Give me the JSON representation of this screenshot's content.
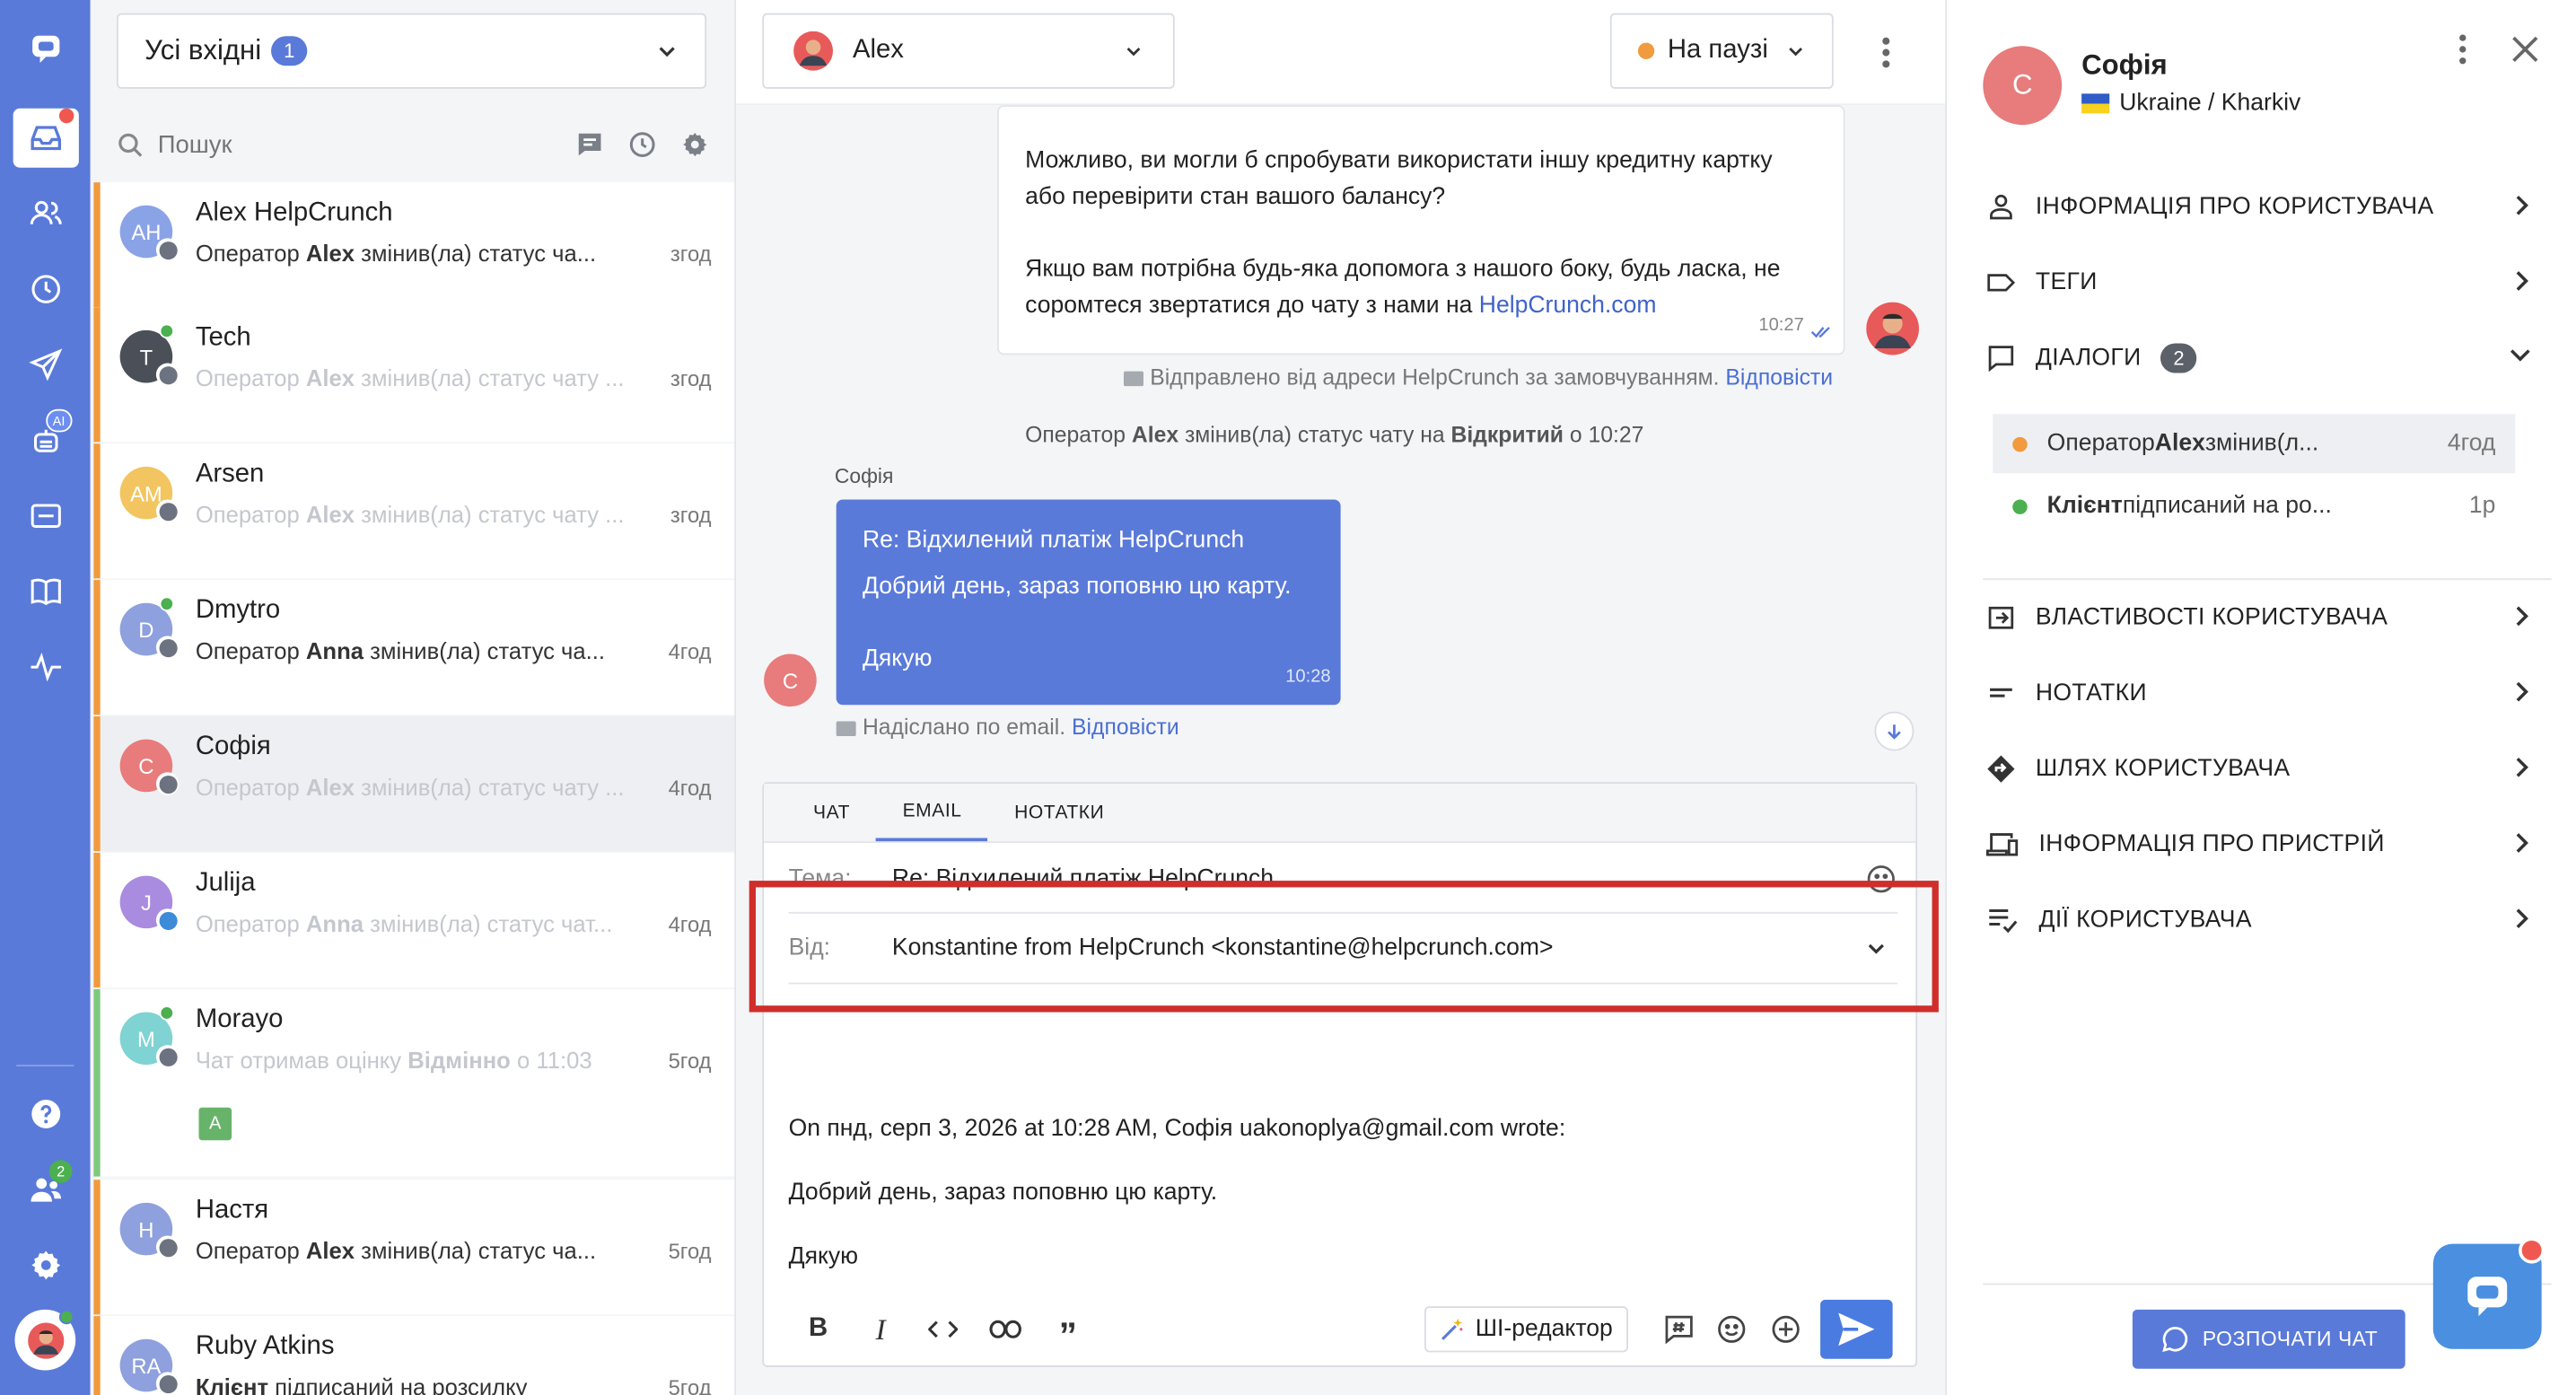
{
  "colors": {
    "rail": "#5a7ad9",
    "accent": "#5a7ad9",
    "offline": "#f19a3e",
    "online": "#4caf50",
    "highlight": "#cf2e2a"
  },
  "inbox": {
    "label": "Усі вхідні",
    "count": "1"
  },
  "search": {
    "placeholder": "Пошук"
  },
  "rail": {
    "ai_badge": "AI",
    "team_count": "2"
  },
  "conversations": [
    {
      "initials": "AH",
      "name": "Alex HelpCrunch",
      "preview": "Оператор Alex змінив(ла) статус ча...",
      "time": "згод",
      "color": "#8aa3e6"
    },
    {
      "initials": "T",
      "name": "Tech",
      "preview": "Оператор Alex змінив(ла) статус чату ...",
      "time": "згод",
      "color": "#4a4f58"
    },
    {
      "initials": "AM",
      "name": "Arsen",
      "preview": "Оператор Alex змінив(ла) статус чату ...",
      "time": "згод",
      "color": "#f3c560"
    },
    {
      "initials": "D",
      "name": "Dmytro",
      "preview": "Оператор Anna змінив(ла) статус ча...",
      "time": "4год",
      "color": "#8ea0dd"
    },
    {
      "initials": "С",
      "name": "Софія",
      "preview": "Оператор Alex змінив(ла) статус чату ...",
      "time": "4год",
      "color": "#e87b7b"
    },
    {
      "initials": "J",
      "name": "Julija",
      "preview": "Оператор Anna змінив(ла) статус чат...",
      "time": "4год",
      "color": "#a98be0"
    },
    {
      "initials": "M",
      "name": "Morayo",
      "preview": "Чат отримав оцінку Відмінно о 11:03",
      "time": "5год",
      "color": "#7fd3d2",
      "rating": "A"
    },
    {
      "initials": "Н",
      "name": "Настя",
      "preview": "Оператор Alex змінив(ла) статус ча...",
      "time": "5год",
      "color": "#8ea0dd"
    },
    {
      "initials": "RA",
      "name": "Ruby Atkins",
      "preview": "Клієнт підписаний на розсилку",
      "time": "5год",
      "color": "#8ea0dd"
    }
  ],
  "chat": {
    "agent": "Alex",
    "status": "На паузі",
    "out_message_1": "Можливо, ви могли б спробувати використати іншу кредитну картку або перевірити стан вашого балансу?",
    "out_message_2": "Якщо вам потрібна будь-яка допомога з нашого боку, будь ласка, не соромтеся звертатися до чату з нами на",
    "out_link": "HelpCrunch.com",
    "out_time": "10:27",
    "sent_from": "Відправлено від адреси HelpCrunch за замовчуванням.",
    "reply": "Відповісти",
    "status_change_a": "Оператор ",
    "status_change_agent": "Alex",
    "status_change_b": " змінив(ла) статус чату на ",
    "status_change_status": "Відкритий",
    "status_change_c": " о 10:27",
    "client_name": "Софія",
    "client_initial": "С",
    "in_subject": "Re: Відхилений платіж HelpCrunch",
    "in_line1": "Добрий день, зараз поповню цю карту.",
    "in_line2": "Дякую",
    "in_time": "10:28",
    "sent_email": "Надіслано по email."
  },
  "composer": {
    "tabs": [
      "ЧАТ",
      "EMAIL",
      "НОТАТКИ"
    ],
    "subject_label": "Тема:",
    "subject_value": "Re: Відхилений платіж HelpCrunch",
    "from_label": "Від:",
    "from_value": "Konstantine from HelpCrunch <konstantine@helpcrunch.com>",
    "quote_header": "On пнд, серп 3, 2026 at 10:28 AM, Софія uakonoplya@gmail.com wrote:",
    "quote_line1": "Добрий день, зараз поповню цю карту.",
    "quote_line2": "Дякую",
    "ai_editor": "ШІ-редактор"
  },
  "user": {
    "initial": "С",
    "name": "Софія",
    "location": "Ukraine / Kharkiv",
    "sections": {
      "info": "ІНФОРМАЦІЯ ПРО КОРИСТУВАЧА",
      "tags": "ТЕГИ",
      "dialogs": "ДІАЛОГИ",
      "dialogs_count": "2",
      "props": "ВЛАСТИВОСТІ КОРИСТУВАЧА",
      "notes": "НОТАТКИ",
      "journey": "ШЛЯХ КОРИСТУВАЧА",
      "device": "ІНФОРМАЦІЯ ПРО ПРИСТРІЙ",
      "actions": "ДІЇ КОРИСТУВАЧА"
    },
    "dialogs": [
      {
        "text_a": "Оператор ",
        "text_b": "Alex",
        "text_c": " змінив(л...",
        "time": "4год",
        "color": "#f19a3e"
      },
      {
        "text_a": "",
        "text_b": "Клієнт",
        "text_c": " підписаний на ро...",
        "time": "1р",
        "color": "#4caf50"
      }
    ],
    "start_chat": "РОЗПОЧАТИ ЧАТ"
  }
}
